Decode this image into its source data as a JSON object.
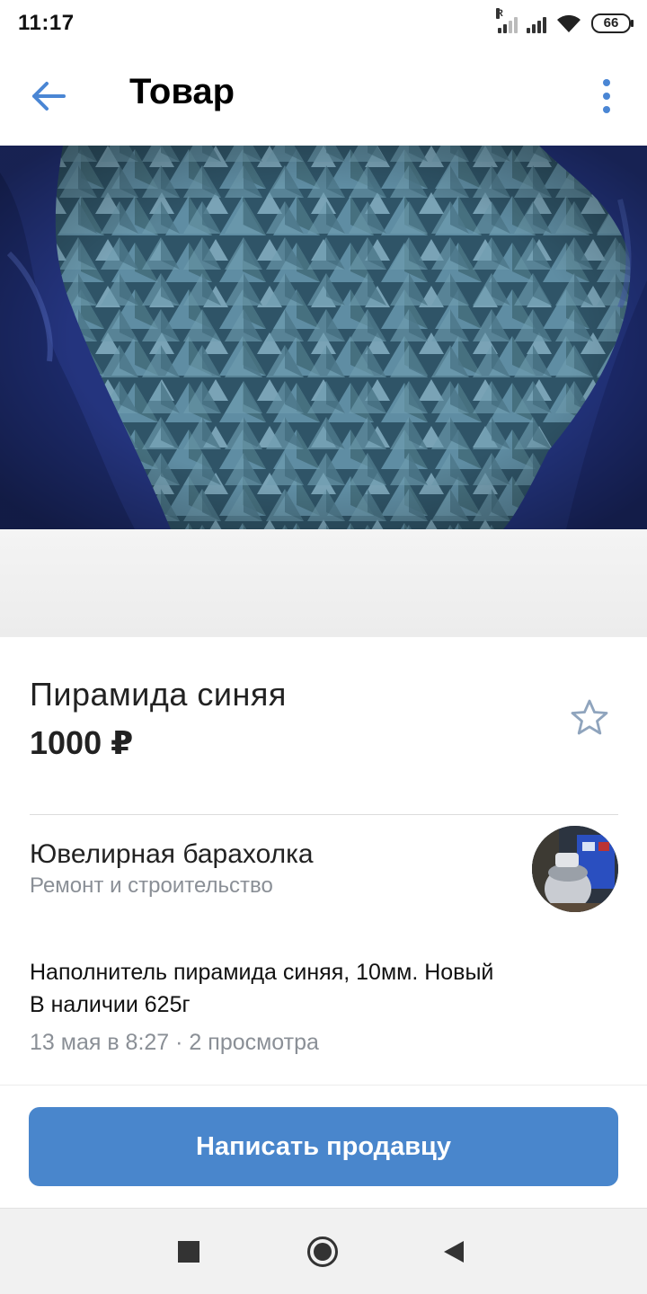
{
  "status_bar": {
    "time": "11:17",
    "battery": "66",
    "roaming_tag": "R"
  },
  "header": {
    "title": "Товар",
    "back_icon": "arrow-left-icon",
    "menu_icon": "more-vertical-icon",
    "accent_color": "#4a86d4"
  },
  "product": {
    "image_icon": "product-photo",
    "title": "Пирамида синяя",
    "price": "1000 ₽",
    "favorite_icon": "star-outline-icon"
  },
  "seller": {
    "name": "Ювелирная барахолка",
    "category": "Ремонт и строительство",
    "avatar_icon": "group-avatar"
  },
  "description": {
    "line1": "Наполнитель пирамида синяя, 10мм. Новый",
    "line2": "В наличии 625г",
    "meta": "13 мая в 8:27 · 2 просмотра"
  },
  "actions": {
    "write_seller": "Написать продавцу",
    "button_color": "#4986cc"
  },
  "navbar": {
    "recent_icon": "square-icon",
    "home_icon": "circle-icon",
    "back_icon": "triangle-back-icon"
  }
}
